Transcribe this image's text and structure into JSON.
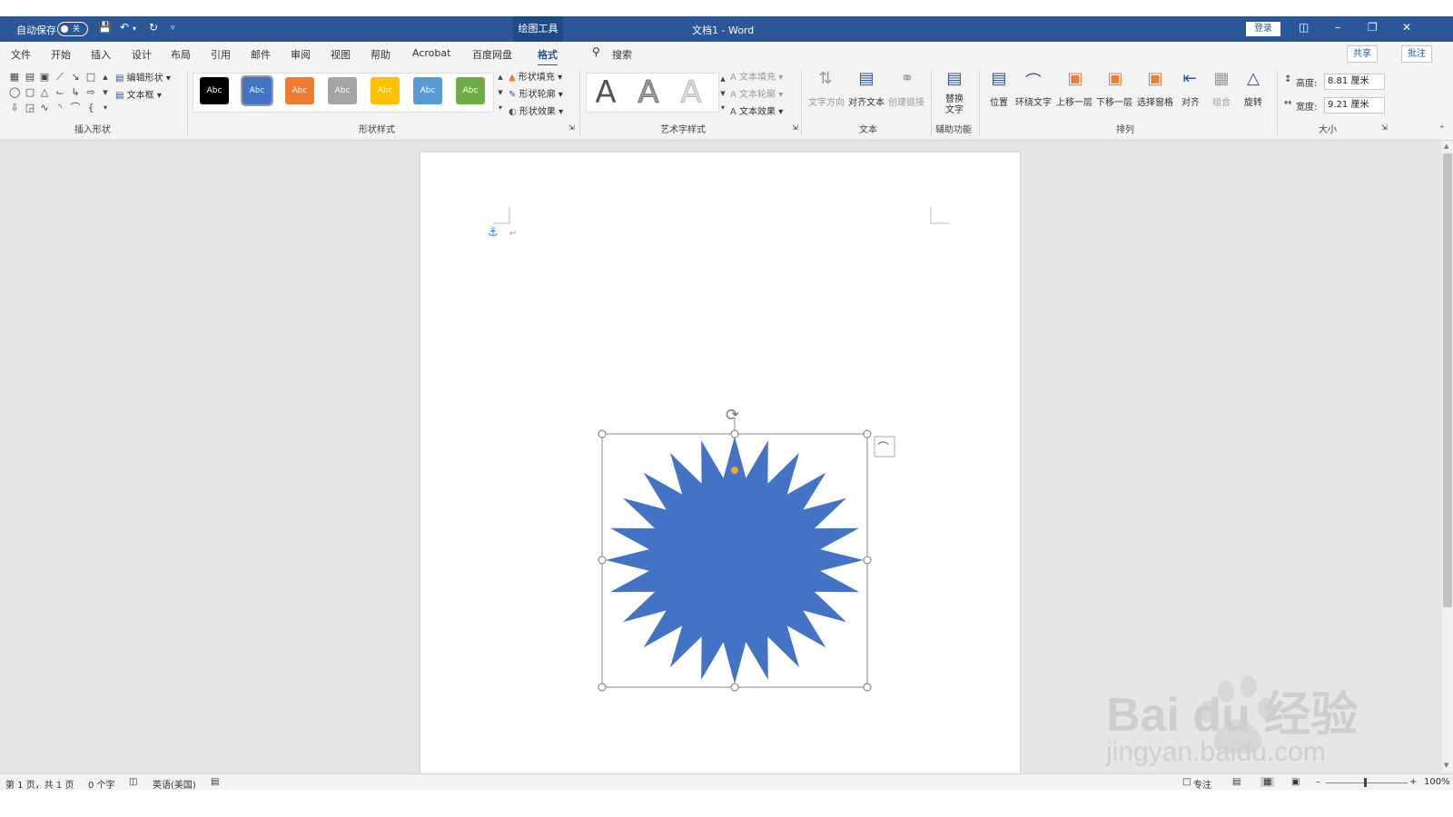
{
  "titlebar": {
    "autosave_label": "自动保存",
    "autosave_state": "关",
    "context_tool": "绘图工具",
    "doc_title": "文档1 - Word",
    "login_label": "登录",
    "bg_color": "#2b579a"
  },
  "menu": {
    "tabs": [
      "文件",
      "开始",
      "插入",
      "设计",
      "布局",
      "引用",
      "邮件",
      "审阅",
      "视图",
      "帮助",
      "Acrobat",
      "百度网盘",
      "格式"
    ],
    "active_tab": "格式",
    "search_label": "搜索",
    "share_label": "共享",
    "comment_label": "批注"
  },
  "ribbon": {
    "insert_shapes": {
      "group_label": "插入形状",
      "edit_shape": "编辑形状",
      "textbox": "文本框"
    },
    "shape_styles": {
      "group_label": "形状样式",
      "swatch_text": "Abc",
      "swatches": [
        "#000000",
        "#4472c4",
        "#ed7d31",
        "#a5a5a5",
        "#ffc000",
        "#5b9bd5",
        "#70ad47"
      ],
      "fill": "形状填充",
      "outline": "形状轮廓",
      "effects": "形状效果"
    },
    "wordart": {
      "group_label": "艺术字样式",
      "letter": "A",
      "text_fill": "文本填充",
      "text_outline": "文本轮廓",
      "text_effects": "文本效果"
    },
    "text": {
      "group_label": "文本",
      "direction": "文字方向",
      "align": "对齐文本",
      "link": "创建链接"
    },
    "accessibility": {
      "group_label": "辅助功能",
      "alt_text": "替换文字"
    },
    "arrange": {
      "group_label": "排列",
      "position": "位置",
      "wrap": "环绕文字",
      "forward": "上移一层",
      "backward": "下移一层",
      "pane": "选择窗格",
      "align": "对齐",
      "group": "组合",
      "rotate": "旋转"
    },
    "size": {
      "group_label": "大小",
      "height_label": "高度:",
      "height_value": "8.81 厘米",
      "width_label": "宽度:",
      "width_value": "9.21 厘米"
    }
  },
  "document": {
    "shape_color": "#4472c4",
    "shape_kind": "24-point-star"
  },
  "statusbar": {
    "page_info": "第 1 页，共 1 页",
    "word_count": "0 个字",
    "language": "英语(美国)",
    "focus": "专注",
    "zoom": "100%"
  },
  "watermark": {
    "brand": "Bai du 经验",
    "url": "jingyan.baidu.com"
  }
}
